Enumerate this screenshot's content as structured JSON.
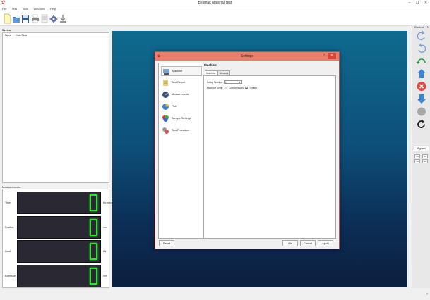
{
  "app": {
    "title": "Besmak Material Test"
  },
  "menu": [
    "File",
    "Test",
    "Tools",
    "Windows",
    "Help"
  ],
  "toolbar": {
    "icons": [
      "new-file-icon",
      "open-folder-icon",
      "save-icon",
      "print-icon",
      "report-icon",
      "settings-gear-icon",
      "download-icon"
    ]
  },
  "series": {
    "label": "Series",
    "columns": [
      "Name",
      "Date/Time"
    ]
  },
  "measurements": {
    "label": "Measurements",
    "rows": [
      {
        "label": "Time",
        "value": "0",
        "unit": "hh:mm:ss"
      },
      {
        "label": "Position",
        "value": "0",
        "unit": "mm"
      },
      {
        "label": "Load",
        "value": "0",
        "unit": "kN"
      },
      {
        "label": "Extension",
        "value": "0",
        "unit": "mm"
      }
    ]
  },
  "control": {
    "title": "Control",
    "close": "✕",
    "bypass_label": "Bypass",
    "small_buttons": [
      "-0+",
      "-0+",
      "-0+",
      "-0+"
    ]
  },
  "status": {
    "corner": "?"
  },
  "dialog": {
    "title": "Settings",
    "help": "?",
    "close": "✕",
    "nav": [
      {
        "label": "Machine"
      },
      {
        "label": "Test Report"
      },
      {
        "label": "Measurements"
      },
      {
        "label": "Plot"
      },
      {
        "label": "Sample Settings"
      },
      {
        "label": "Test Procedure"
      }
    ],
    "page_title": "Machine",
    "tabs": [
      "Machine",
      "Sensors"
    ],
    "setup_label": "Setup Number:",
    "setup_value": "1",
    "machine_type_label": "Machine Type:",
    "opt_compression": "Compression",
    "opt_tensile": "Tensile",
    "selected_machine_type": "Tensile",
    "reset": "Reset",
    "ok": "OK",
    "cancel": "Cancel",
    "apply": "Apply"
  },
  "colors": {
    "accent": "#ef7b6b",
    "digit": "#2fe02f",
    "canvas_top": "#0e6a8e",
    "canvas_bottom": "#0b1f3f"
  }
}
